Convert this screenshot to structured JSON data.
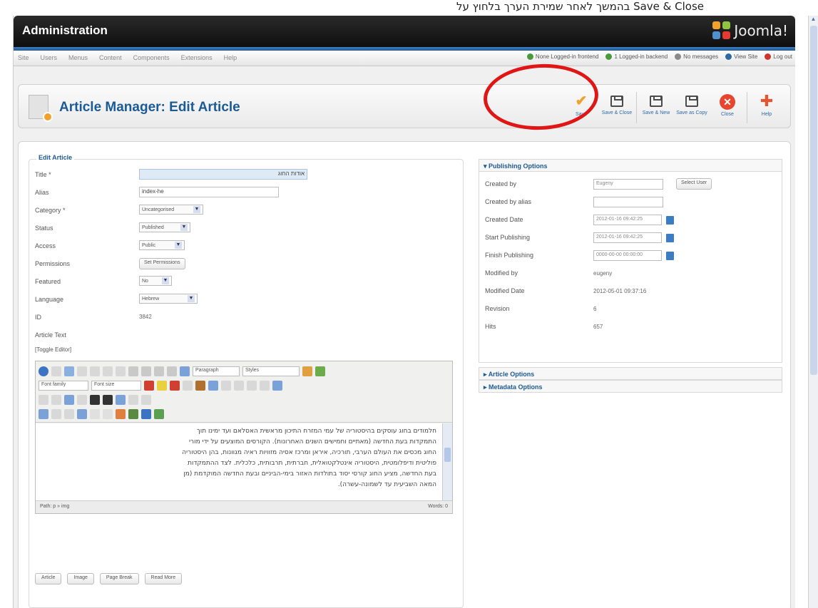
{
  "caption": "בהמשך לאחר שמירת הערך בלחוץ על Save & Close",
  "header": {
    "title": "Administration",
    "logo_text": "Joomla!"
  },
  "menu": {
    "items": [
      "Site",
      "Users",
      "Menus",
      "Content",
      "Components",
      "Extensions",
      "Help"
    ],
    "status": [
      {
        "label": "None Logged-in frontend",
        "color": "#4a9a3c"
      },
      {
        "label": "1 Logged-in backend",
        "color": "#4a9a3c"
      },
      {
        "label": "No messages",
        "color": "#8a8a8a"
      },
      {
        "label": "View Site",
        "color": "#2d69a5"
      },
      {
        "label": "Log out",
        "color": "#d0342c"
      }
    ]
  },
  "toolbar": {
    "page_title": "Article Manager: Edit Article",
    "buttons": [
      {
        "label": "Save",
        "icon": "check-icon",
        "color": "#f0a22c"
      },
      {
        "label": "Save & Close",
        "icon": "save-close-icon",
        "color": "#4b4b4b"
      },
      {
        "label": "Save & New",
        "icon": "save-new-icon",
        "color": "#4b4b4b"
      },
      {
        "label": "Save as Copy",
        "icon": "save-copy-icon",
        "color": "#4b4b4b"
      },
      {
        "label": "Close",
        "icon": "close-icon",
        "color": "#e8452f"
      },
      {
        "label": "Help",
        "icon": "help-icon",
        "color": "#e8542f"
      }
    ]
  },
  "form": {
    "legend": "Edit Article",
    "labels": {
      "title": "Title *",
      "alias": "Alias",
      "category": "Category *",
      "status": "Status",
      "access": "Access",
      "permissions": "Permissions",
      "featured": "Featured",
      "language": "Language",
      "id": "ID",
      "article_text": "Article Text"
    },
    "values": {
      "title": "אודות החוג",
      "alias": "index-he",
      "category": "Uncategorised",
      "status": "Published",
      "access": "Public",
      "permissions_button": "Set Permissions",
      "featured": "No",
      "language": "Hebrew",
      "id": "3842"
    },
    "toggle_editor": "[Toggle Editor]"
  },
  "editor": {
    "format_select": "Paragraph",
    "styles_select": "Styles",
    "font_family": "Font family",
    "font_size": "Font size",
    "text_lines": [
      "חלמודים בחוג עוסקים בהיסטוריה של עמי המזרח התיכון מראשית האסלאם ועד ימינו תוך",
      "התמקדות בעת החדשה (מאתיים וחמישים השנים האחרונות). הקורסים המוצעים על ידי מורי",
      "החוג מכסים את העולם הערבי, תורכיה, איראן ומרכז אסיה מזוויות ראיה מגוונות, בהן היסטוריה",
      "פוליטית ודיפלומטית, היסטוריה אינטלקטואלית, חברתית, תרבותית, כלכלית. לצד ההתמקדות",
      "בעת החדשה, מציע החוג קורסי יסוד בתולדות האזור בימי-הביניים ובעת החדשה המוקדמת (מן",
      "המאה השביעית עד לשמונה-עשרה)."
    ],
    "path": "Path: p » img",
    "words": "Words: 0",
    "buttons": [
      "Article",
      "Image",
      "Page Break",
      "Read More"
    ]
  },
  "publishing": {
    "title": "Publishing Options",
    "rows": [
      {
        "label": "Created by",
        "value": "Eugeny",
        "kind": "input-btn",
        "button": "Select User"
      },
      {
        "label": "Created by alias",
        "value": "",
        "kind": "input"
      },
      {
        "label": "Created Date",
        "value": "2012-01-16 09:42:25",
        "kind": "date"
      },
      {
        "label": "Start Publishing",
        "value": "2012-01-16 09:42:25",
        "kind": "date"
      },
      {
        "label": "Finish Publishing",
        "value": "0000-00-00 00:00:00",
        "kind": "date"
      },
      {
        "label": "Modified by",
        "value": "eugeny",
        "kind": "text"
      },
      {
        "label": "Modified Date",
        "value": "2012-05-01 09:37:16",
        "kind": "text"
      },
      {
        "label": "Revision",
        "value": "6",
        "kind": "text"
      },
      {
        "label": "Hits",
        "value": "657",
        "kind": "text"
      }
    ]
  },
  "article_options": "Article Options",
  "metadata_options": "Metadata Options"
}
